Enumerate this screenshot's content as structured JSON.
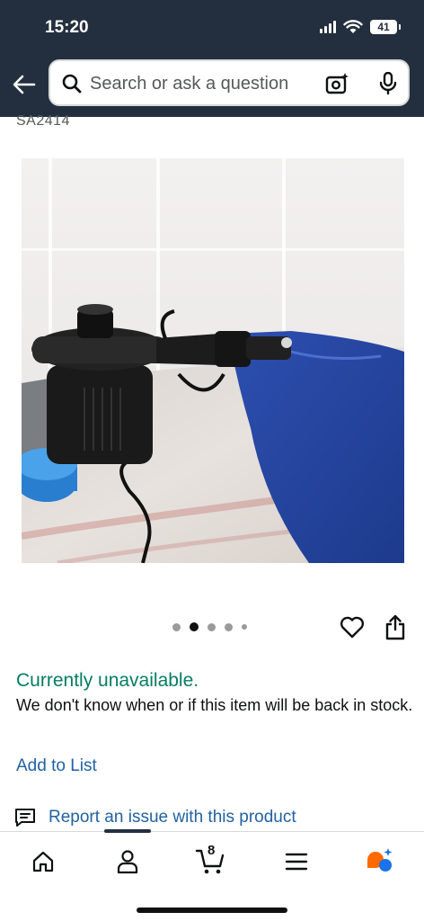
{
  "status_bar": {
    "time": "15:20",
    "battery": "41"
  },
  "search": {
    "placeholder": "Search or ask a question"
  },
  "product": {
    "model_number": "SA2414",
    "image": "black electric air pump attached to blue inflatable",
    "carousel": {
      "total_images": 5,
      "active_index": 1
    },
    "availability": "Currently unavailable.",
    "availability_note": "We don't know when or if this item will be back in stock.",
    "add_to_list": "Add to List",
    "report_issue": "Report an issue with this product"
  },
  "bottom_nav": {
    "items": [
      {
        "name": "home",
        "icon": "home-icon"
      },
      {
        "name": "account",
        "icon": "person-icon"
      },
      {
        "name": "cart",
        "icon": "cart-icon",
        "count": "8"
      },
      {
        "name": "menu",
        "icon": "hamburger-icon"
      },
      {
        "name": "rufus",
        "icon": "assistant-icon"
      }
    ]
  },
  "colors": {
    "header_bg": "#232f3e",
    "availability_green": "#067d62",
    "link_blue": "#2162a1",
    "assistant_orange": "#ff6a00",
    "assistant_blue": "#1a73e8"
  }
}
